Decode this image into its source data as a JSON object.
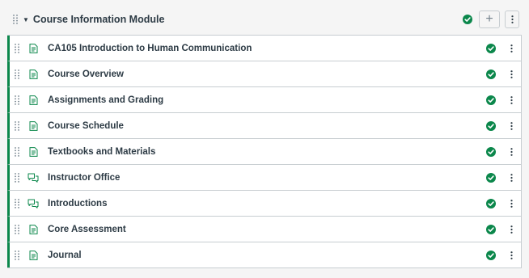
{
  "module": {
    "title": "Course Information Module",
    "add_label": "+",
    "published": true,
    "items": [
      {
        "title": "CA105 Introduction to Human Communication",
        "type": "page"
      },
      {
        "title": "Course Overview",
        "type": "page"
      },
      {
        "title": "Assignments and Grading",
        "type": "page"
      },
      {
        "title": "Course Schedule",
        "type": "page"
      },
      {
        "title": "Textbooks and Materials",
        "type": "page"
      },
      {
        "title": "Instructor Office",
        "type": "discussion"
      },
      {
        "title": "Introductions",
        "type": "discussion"
      },
      {
        "title": "Core Assessment",
        "type": "page"
      },
      {
        "title": "Journal",
        "type": "page"
      }
    ]
  },
  "colors": {
    "published_green": "#0b874b",
    "icon_gray": "#73818c",
    "text": "#2d3b45",
    "border": "#c7cdd1"
  }
}
